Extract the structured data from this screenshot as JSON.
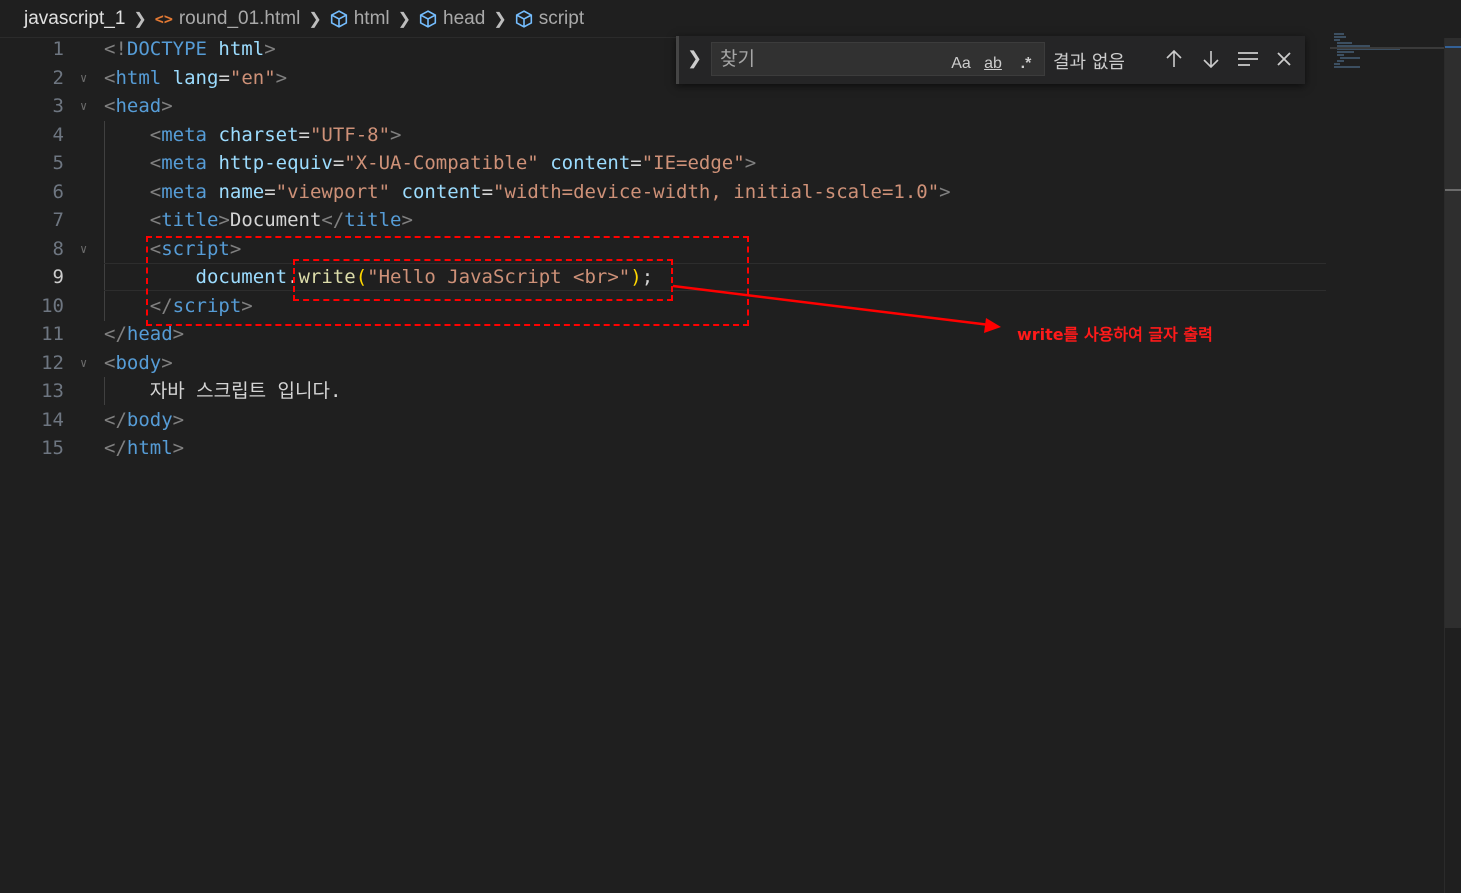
{
  "breadcrumb": {
    "items": [
      {
        "label": "javascript_1",
        "icon": "folder"
      },
      {
        "label": "round_01.html",
        "icon": "html-file-icon"
      },
      {
        "label": "html",
        "icon": "cube-icon"
      },
      {
        "label": "head",
        "icon": "cube-icon"
      },
      {
        "label": "script",
        "icon": "cube-icon"
      }
    ]
  },
  "editor": {
    "active_line": 9,
    "lines": [
      {
        "n": "1",
        "tokens": [
          [
            "t-br",
            "<!"
          ],
          [
            "t-tag",
            "DOCTYPE"
          ],
          [
            "t-txt",
            " "
          ],
          [
            "t-attr",
            "html"
          ],
          [
            "t-br",
            ">"
          ]
        ]
      },
      {
        "n": "2",
        "tokens": [
          [
            "t-br",
            "<"
          ],
          [
            "t-tag",
            "html"
          ],
          [
            "t-txt",
            " "
          ],
          [
            "t-attr",
            "lang"
          ],
          [
            "t-txt",
            "="
          ],
          [
            "t-str",
            "\"en\""
          ],
          [
            "t-br",
            ">"
          ]
        ]
      },
      {
        "n": "3",
        "tokens": [
          [
            "t-br",
            "<"
          ],
          [
            "t-tag",
            "head"
          ],
          [
            "t-br",
            ">"
          ]
        ]
      },
      {
        "n": "4",
        "tokens": [
          [
            "t-txt",
            "    "
          ],
          [
            "t-br",
            "<"
          ],
          [
            "t-tag",
            "meta"
          ],
          [
            "t-txt",
            " "
          ],
          [
            "t-attr",
            "charset"
          ],
          [
            "t-txt",
            "="
          ],
          [
            "t-str",
            "\"UTF-8\""
          ],
          [
            "t-br",
            ">"
          ]
        ]
      },
      {
        "n": "5",
        "tokens": [
          [
            "t-txt",
            "    "
          ],
          [
            "t-br",
            "<"
          ],
          [
            "t-tag",
            "meta"
          ],
          [
            "t-txt",
            " "
          ],
          [
            "t-attr",
            "http-equiv"
          ],
          [
            "t-txt",
            "="
          ],
          [
            "t-str",
            "\"X-UA-Compatible\""
          ],
          [
            "t-txt",
            " "
          ],
          [
            "t-attr",
            "content"
          ],
          [
            "t-txt",
            "="
          ],
          [
            "t-str",
            "\"IE=edge\""
          ],
          [
            "t-br",
            ">"
          ]
        ]
      },
      {
        "n": "6",
        "tokens": [
          [
            "t-txt",
            "    "
          ],
          [
            "t-br",
            "<"
          ],
          [
            "t-tag",
            "meta"
          ],
          [
            "t-txt",
            " "
          ],
          [
            "t-attr",
            "name"
          ],
          [
            "t-txt",
            "="
          ],
          [
            "t-str",
            "\"viewport\""
          ],
          [
            "t-txt",
            " "
          ],
          [
            "t-attr",
            "content"
          ],
          [
            "t-txt",
            "="
          ],
          [
            "t-str",
            "\"width=device-width, initial-scale=1.0\""
          ],
          [
            "t-br",
            ">"
          ]
        ]
      },
      {
        "n": "7",
        "tokens": [
          [
            "t-txt",
            "    "
          ],
          [
            "t-br",
            "<"
          ],
          [
            "t-tag",
            "title"
          ],
          [
            "t-br",
            ">"
          ],
          [
            "t-txt",
            "Document"
          ],
          [
            "t-br",
            "</"
          ],
          [
            "t-tag",
            "title"
          ],
          [
            "t-br",
            ">"
          ]
        ]
      },
      {
        "n": "8",
        "tokens": [
          [
            "t-txt",
            "    "
          ],
          [
            "t-br",
            "<"
          ],
          [
            "t-tag",
            "script"
          ],
          [
            "t-br",
            ">"
          ]
        ]
      },
      {
        "n": "9",
        "tokens": [
          [
            "t-txt",
            "        "
          ],
          [
            "t-var",
            "document"
          ],
          [
            "t-txt",
            "."
          ],
          [
            "t-fn",
            "write"
          ],
          [
            "t-paren",
            "("
          ],
          [
            "t-str",
            "\"Hello JavaScript <br>\""
          ],
          [
            "t-paren",
            ")"
          ],
          [
            "t-txt",
            ";"
          ]
        ]
      },
      {
        "n": "10",
        "tokens": [
          [
            "t-txt",
            "    "
          ],
          [
            "t-br",
            "</"
          ],
          [
            "t-tag",
            "script"
          ],
          [
            "t-br",
            ">"
          ]
        ]
      },
      {
        "n": "11",
        "tokens": [
          [
            "t-br",
            "</"
          ],
          [
            "t-tag",
            "head"
          ],
          [
            "t-br",
            ">"
          ]
        ]
      },
      {
        "n": "12",
        "tokens": [
          [
            "t-br",
            "<"
          ],
          [
            "t-tag",
            "body"
          ],
          [
            "t-br",
            ">"
          ]
        ]
      },
      {
        "n": "13",
        "tokens": [
          [
            "t-txt",
            "    자바 스크립트 입니다."
          ]
        ]
      },
      {
        "n": "14",
        "tokens": [
          [
            "t-br",
            "</"
          ],
          [
            "t-tag",
            "body"
          ],
          [
            "t-br",
            ">"
          ]
        ]
      },
      {
        "n": "15",
        "tokens": [
          [
            "t-br",
            "</"
          ],
          [
            "t-tag",
            "html"
          ],
          [
            "t-br",
            ">"
          ]
        ]
      }
    ]
  },
  "find_widget": {
    "placeholder": "찾기",
    "match_case": "Aa",
    "whole_word": "ab",
    "regex": ".*",
    "result": "결과 없음"
  },
  "annotation": {
    "note": "write를 사용하여 글자 출력",
    "color": "#ff0000"
  }
}
